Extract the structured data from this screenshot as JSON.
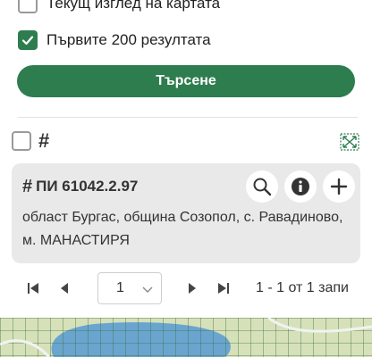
{
  "filters": {
    "current_view_label": "Текущ изглед на картата",
    "current_view_checked": false,
    "first_results_label": "Първите 200 резултата",
    "first_results_checked": true
  },
  "search_button_label": "Търсене",
  "results_header": {
    "select_all_checked": false,
    "hash_symbol": "#"
  },
  "result": {
    "hash_symbol": "#",
    "title": "ПИ 61042.2.97",
    "address": "област Бургас, община Созопол, с. Равадиново, м. МАНАСТИРЯ"
  },
  "pager": {
    "current_page": "1",
    "info": "1 - 1 от 1 запи"
  },
  "colors": {
    "accent": "#2e7d4f",
    "card_bg": "#e9e9e9",
    "map_water": "#6aa5cf",
    "map_land": "#c9d9a5"
  }
}
